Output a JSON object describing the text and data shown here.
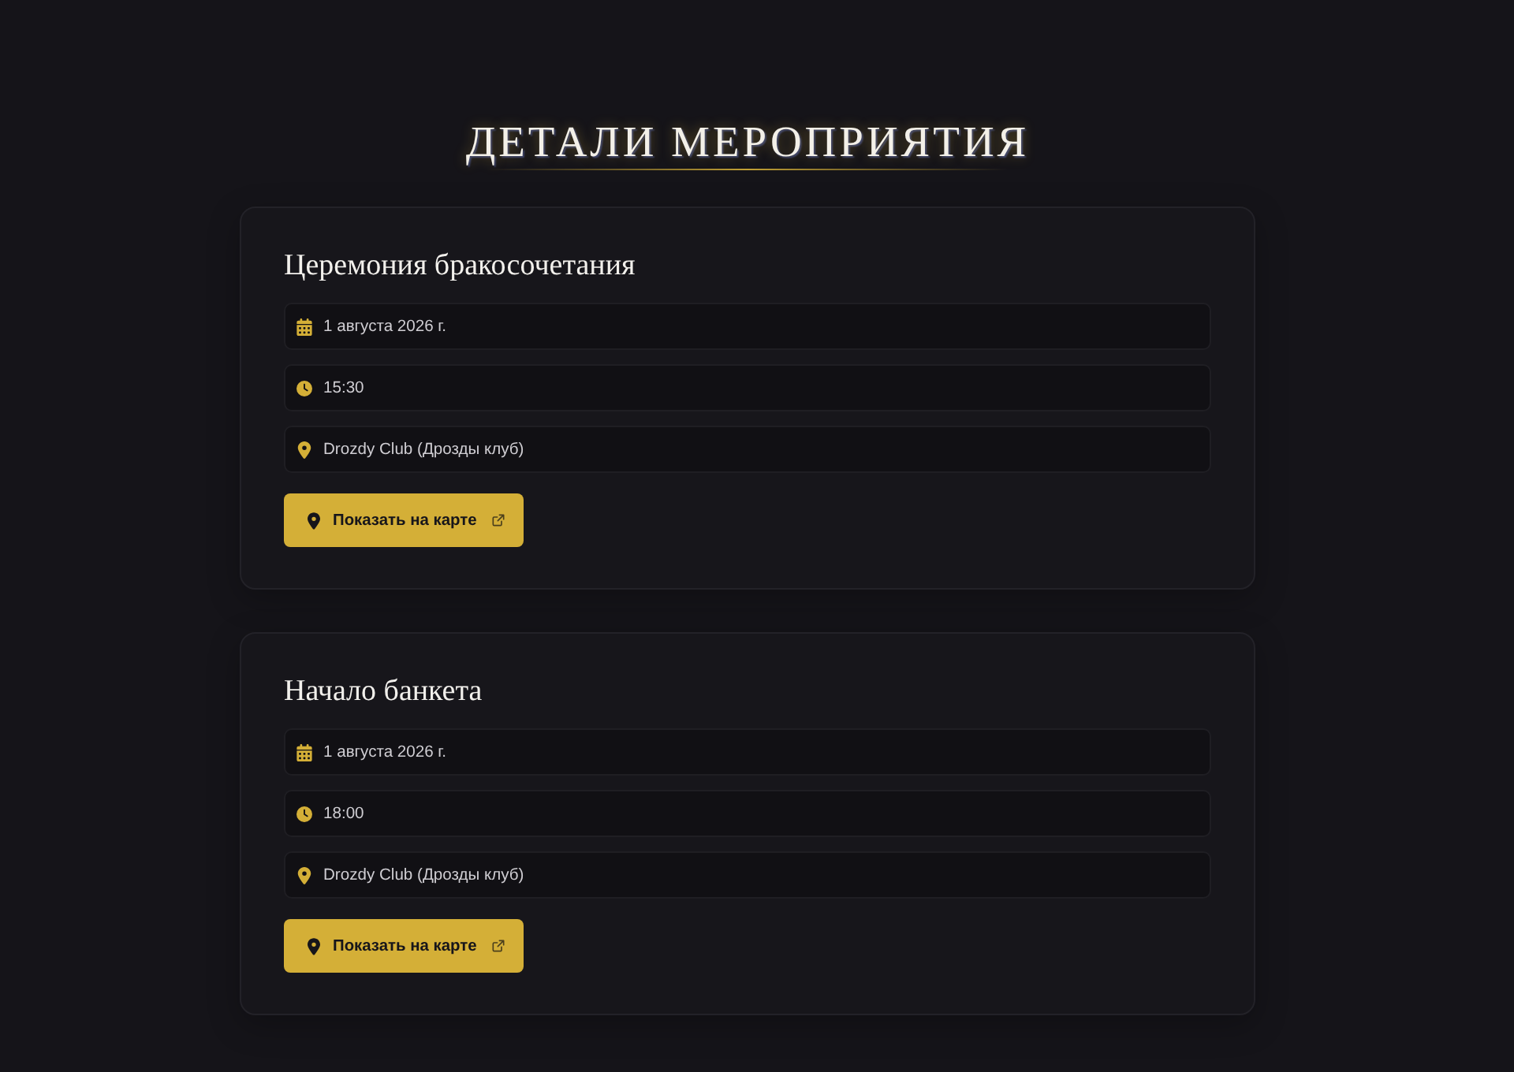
{
  "title": "ДЕТАЛИ МЕРОПРИЯТИЯ",
  "events": [
    {
      "heading": "Церемония бракосочетания",
      "details": [
        {
          "kind": "date",
          "text": "1 августа 2026 г."
        },
        {
          "kind": "time",
          "text": "15:30"
        },
        {
          "kind": "place",
          "text": "Drozdy Club (Дрозды клуб)"
        }
      ],
      "button": "Показать на карте"
    },
    {
      "heading": "Начало банкета",
      "details": [
        {
          "kind": "date",
          "text": "1 августа 2026 г."
        },
        {
          "kind": "time",
          "text": "18:00"
        },
        {
          "kind": "place",
          "text": "Drozdy Club (Дрозды клуб)"
        }
      ],
      "button": "Показать на карте"
    }
  ]
}
